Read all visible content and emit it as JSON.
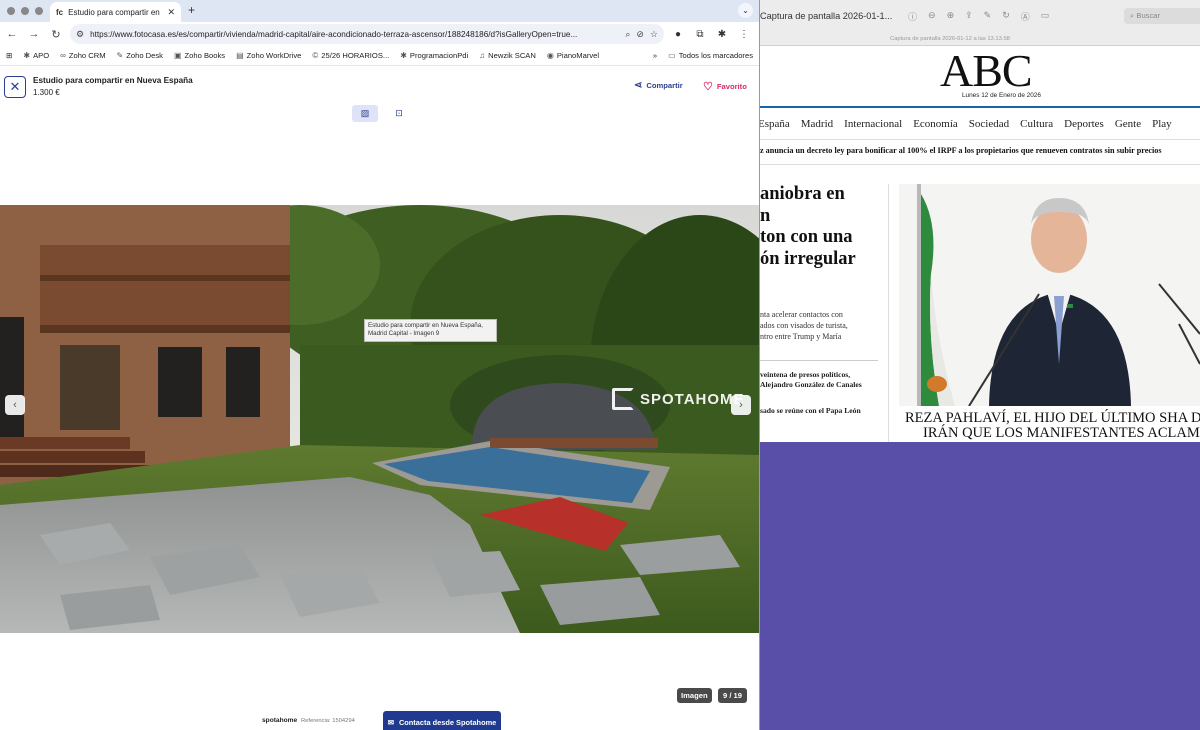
{
  "browser": {
    "tab_title": "Estudio para compartir en Nueva España",
    "tab_favicon": "fc",
    "url": "https://www.fotocasa.es/es/compartir/vivienda/madrid-capital/aire-acondicionado-terraza-ascensor/188248186/d?isGalleryOpen=true...",
    "bookmarks": [
      {
        "label": "APO",
        "icon": "ast-icon"
      },
      {
        "label": "Zoho CRM",
        "icon": "zoho-icon"
      },
      {
        "label": "Zoho Desk",
        "icon": "zoho-icon"
      },
      {
        "label": "Zoho Books",
        "icon": "zoho-icon"
      },
      {
        "label": "Zoho WorkDrive",
        "icon": "zoho-icon"
      },
      {
        "label": "25/26 HORARIOS...",
        "icon": "c-icon"
      },
      {
        "label": "ProgramacionPdi",
        "icon": "ast-icon"
      },
      {
        "label": "Newzik SCAN",
        "icon": "newzik-icon"
      },
      {
        "label": "PianoMarvel",
        "icon": "piano-icon"
      }
    ],
    "all_bookmarks": "Todos los marcadores",
    "more_bookmarks": "»"
  },
  "listing": {
    "title": "Estudio para compartir en Nueva España",
    "price": "1.300 €",
    "share": "Compartir",
    "favorite": "Favorito",
    "watermark": "SPOTAHOME",
    "tooltip_line1": "Estudio para compartir en Nueva España,",
    "tooltip_line2": "Madrid Capital - Imagen 9",
    "badge_type": "Imagen",
    "counter": "9 / 19",
    "footer_brand": "spotahome",
    "reference": "Referencia: 1504294",
    "contact": "Contacta desde Spotahome"
  },
  "preview": {
    "title": "Captura de pantalla 2026-01-1...",
    "subtitle": "Captura de pantalla 2026-01-12 a las 13.13.58",
    "search_placeholder": "Buscar"
  },
  "abc": {
    "logo": "ABC",
    "date": "Lunes 12 de Enero de 2026",
    "nav": [
      "España",
      "Madrid",
      "Internacional",
      "Economía",
      "Sociedad",
      "Cultura",
      "Deportes",
      "Gente",
      "Play"
    ],
    "ticker": "z anuncia un decreto ley para bonificar al 100% el IRPF a los propietarios que renueven contratos sin subir precios",
    "headline": [
      "aniobra en",
      "n",
      "ton con una",
      "ón irregular"
    ],
    "subhead": [
      "nta acelerar contactos con",
      "ados con visados de turista,",
      "ntro entre Trump y María"
    ],
    "brief1": [
      "veintena de presos políticos,",
      "Alejandro González de Canales"
    ],
    "brief2": "sado se reúne con el Papa León",
    "caption": [
      "REZA PAHLAVÍ, EL HIJO DEL ÚLTIMO SHA D",
      "IRÁN QUE LOS MANIFESTANTES ACLAMAN"
    ]
  },
  "colors": {
    "accent": "#2c3e8f",
    "favorite": "#d62a6a",
    "contact_button": "#1f3a8f",
    "abc_rule": "#1565a8",
    "desktop": "#5a4fa8"
  }
}
